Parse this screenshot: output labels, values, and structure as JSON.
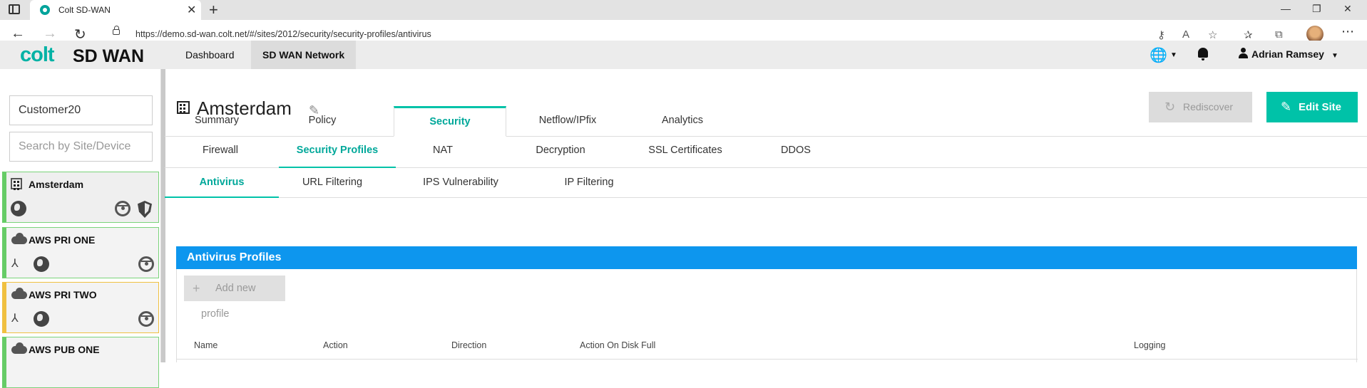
{
  "browser": {
    "tab_title": "Colt SD-WAN",
    "url": "https://demo.sd-wan.colt.net/#/sites/2012/security/security-profiles/antivirus",
    "icons": [
      "window-menu-icon",
      "back-icon",
      "forward-icon",
      "refresh-icon",
      "lock-icon",
      "key-icon",
      "read-aloud-icon",
      "favorite-add-icon",
      "favorites-icon",
      "collections-icon",
      "profile-icon",
      "more-icon"
    ]
  },
  "header": {
    "logo_colt": "colt",
    "logo_sdwan": "SD WAN",
    "nav": [
      "Dashboard",
      "SD WAN Network"
    ],
    "active_nav": "SD WAN Network",
    "user_name": "Adrian Ramsey"
  },
  "sidebar": {
    "customer_value": "Customer20",
    "search_placeholder": "Search by Site/Device",
    "sites": [
      {
        "name": "Amsterdam",
        "type": "building",
        "status_color": "#66cc66",
        "icons": [
          "globe-icon",
          "steering-wheel-icon",
          "shield-icon"
        ]
      },
      {
        "name": "AWS PRI ONE",
        "type": "cloud",
        "status_color": "#66cc66",
        "icons": [
          "topology-icon",
          "globe-icon",
          "steering-wheel-icon"
        ]
      },
      {
        "name": "AWS PRI TWO",
        "type": "cloud",
        "status_color": "#f0c040",
        "icons": [
          "topology-icon",
          "globe-icon",
          "steering-wheel-icon"
        ]
      },
      {
        "name": "AWS PUB ONE",
        "type": "cloud",
        "status_color": "#66cc66",
        "icons": []
      }
    ]
  },
  "main": {
    "site_title": "Amsterdam",
    "rediscover_label": "Rediscover",
    "edit_label": "Edit Site",
    "tabs": [
      "Summary",
      "Policy",
      "Security",
      "Netflow/IPfix",
      "Analytics"
    ],
    "active_tab": "Security",
    "security_tabs": [
      "Firewall",
      "Security Profiles",
      "NAT",
      "Decryption",
      "SSL Certificates",
      "DDOS"
    ],
    "active_security_tab": "Security Profiles",
    "profile_tabs": [
      "Antivirus",
      "URL Filtering",
      "IPS Vulnerability",
      "IP Filtering"
    ],
    "active_profile_tab": "Antivirus",
    "panel_title": "Antivirus Profiles",
    "add_label": "Add new profile",
    "columns": [
      "Name",
      "Action",
      "Direction",
      "Action On Disk Full",
      "Logging"
    ]
  },
  "colors": {
    "accent": "#00c2a8",
    "panel": "#0d96ee"
  }
}
